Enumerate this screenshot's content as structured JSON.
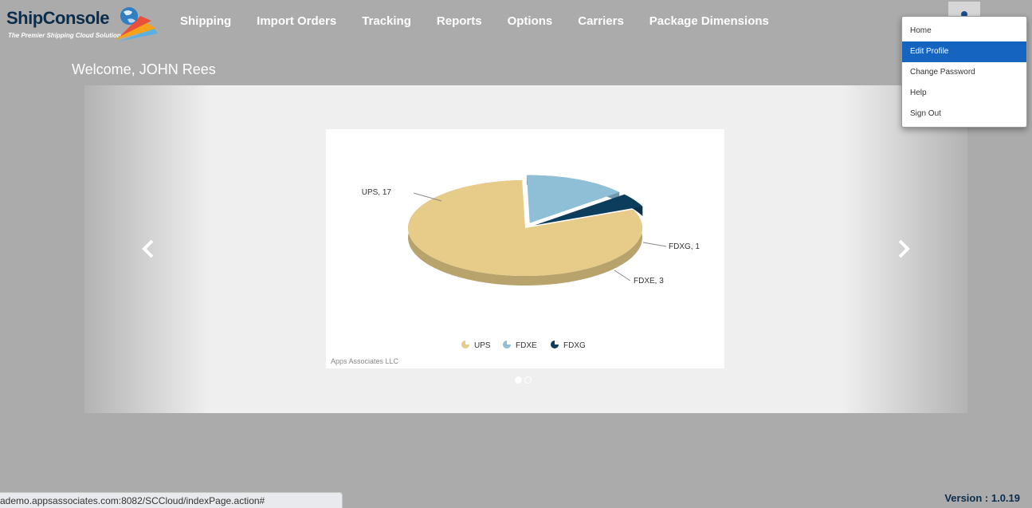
{
  "logo": {
    "title": "ShipConsole",
    "subtitle": "The Premier Shipping Cloud Solution"
  },
  "nav": [
    "Shipping",
    "Import Orders",
    "Tracking",
    "Reports",
    "Options",
    "Carriers",
    "Package Dimensions"
  ],
  "user_menu": {
    "items": [
      "Home",
      "Edit Profile",
      "Change Password",
      "Help",
      "Sign Out"
    ],
    "active_index": 1
  },
  "welcome": "Welcome, JOHN Rees",
  "chart_data": {
    "type": "pie",
    "categories": [
      "UPS",
      "FDXE",
      "FDXG"
    ],
    "values": [
      17,
      3,
      1
    ],
    "labels": [
      "UPS, 17",
      "FDXE, 3",
      "FDXG, 1"
    ],
    "colors": [
      "#e6cc88",
      "#8fbfd6",
      "#0d3d5c"
    ],
    "legend": "bottom",
    "credit": "Apps Associates LLC"
  },
  "carousel": {
    "slides": 2,
    "active": 0
  },
  "status_url": "ademo.appsassociates.com:8082/SCCloud/indexPage.action#",
  "version": "Version : 1.0.19"
}
